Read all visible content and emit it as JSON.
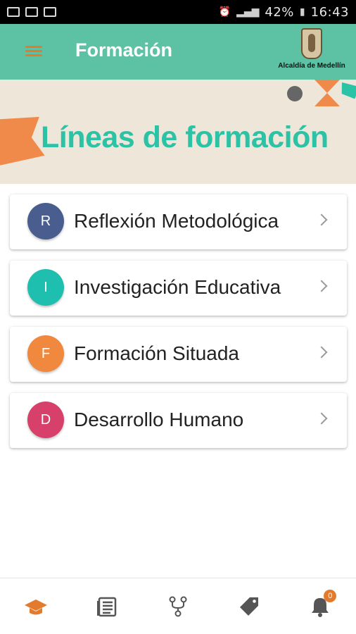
{
  "status_bar": {
    "battery_percent": "42%",
    "time": "16:43"
  },
  "app_bar": {
    "title": "Formación",
    "logo_text": "Alcaldía de Medellín",
    "background": "#5dc2a4",
    "menu_icon_color": "#e27b2d"
  },
  "banner": {
    "title": "Líneas de formación",
    "title_color": "#2cc2a6"
  },
  "lines": [
    {
      "initial": "R",
      "label": "Reflexión Metodológica",
      "color": "#4a5d8f"
    },
    {
      "initial": "I",
      "label": "Investigación Educativa",
      "color": "#1fbfb0"
    },
    {
      "initial": "F",
      "label": "Formación Situada",
      "color": "#f0883e"
    },
    {
      "initial": "D",
      "label": "Desarrollo Humano",
      "color": "#d6406b"
    }
  ],
  "bottom_nav": {
    "items": [
      "graduation-cap-icon",
      "news-icon",
      "network-icon",
      "tag-icon",
      "bell-icon"
    ],
    "active_color": "#e27b2d",
    "inactive_color": "#555555",
    "notification_count": "0"
  }
}
